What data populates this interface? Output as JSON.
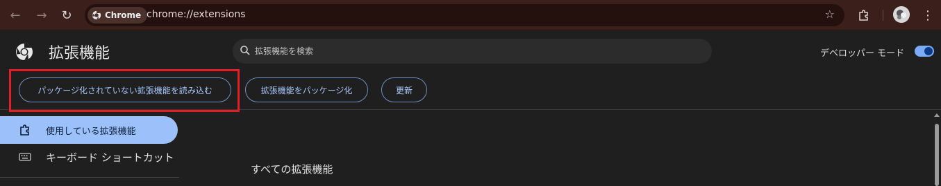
{
  "browser": {
    "chip_label": "Chrome",
    "url": "chrome://extensions"
  },
  "page": {
    "title": "拡張機能",
    "search_placeholder": "拡張機能を検索",
    "developer_mode_label": "デベロッパー モード",
    "developer_mode_enabled": true
  },
  "actions": {
    "load_unpacked": "パッケージ化されていない拡張機能を読み込む",
    "pack_extension": "拡張機能をパッケージ化",
    "update": "更新"
  },
  "sidebar": {
    "items": [
      {
        "label": "使用している拡張機能",
        "icon": "extension-puzzle-icon",
        "active": true
      },
      {
        "label": "キーボード ショートカット",
        "icon": "keyboard-icon",
        "active": false
      }
    ]
  },
  "main": {
    "section_title": "すべての拡張機能"
  },
  "colors": {
    "toolbar_bg": "#3a1f1a",
    "page_bg": "#1f1f1f",
    "accent": "#a8c7fa",
    "active_sidebar": "#9cc0f9",
    "highlight": "#e51d26"
  }
}
